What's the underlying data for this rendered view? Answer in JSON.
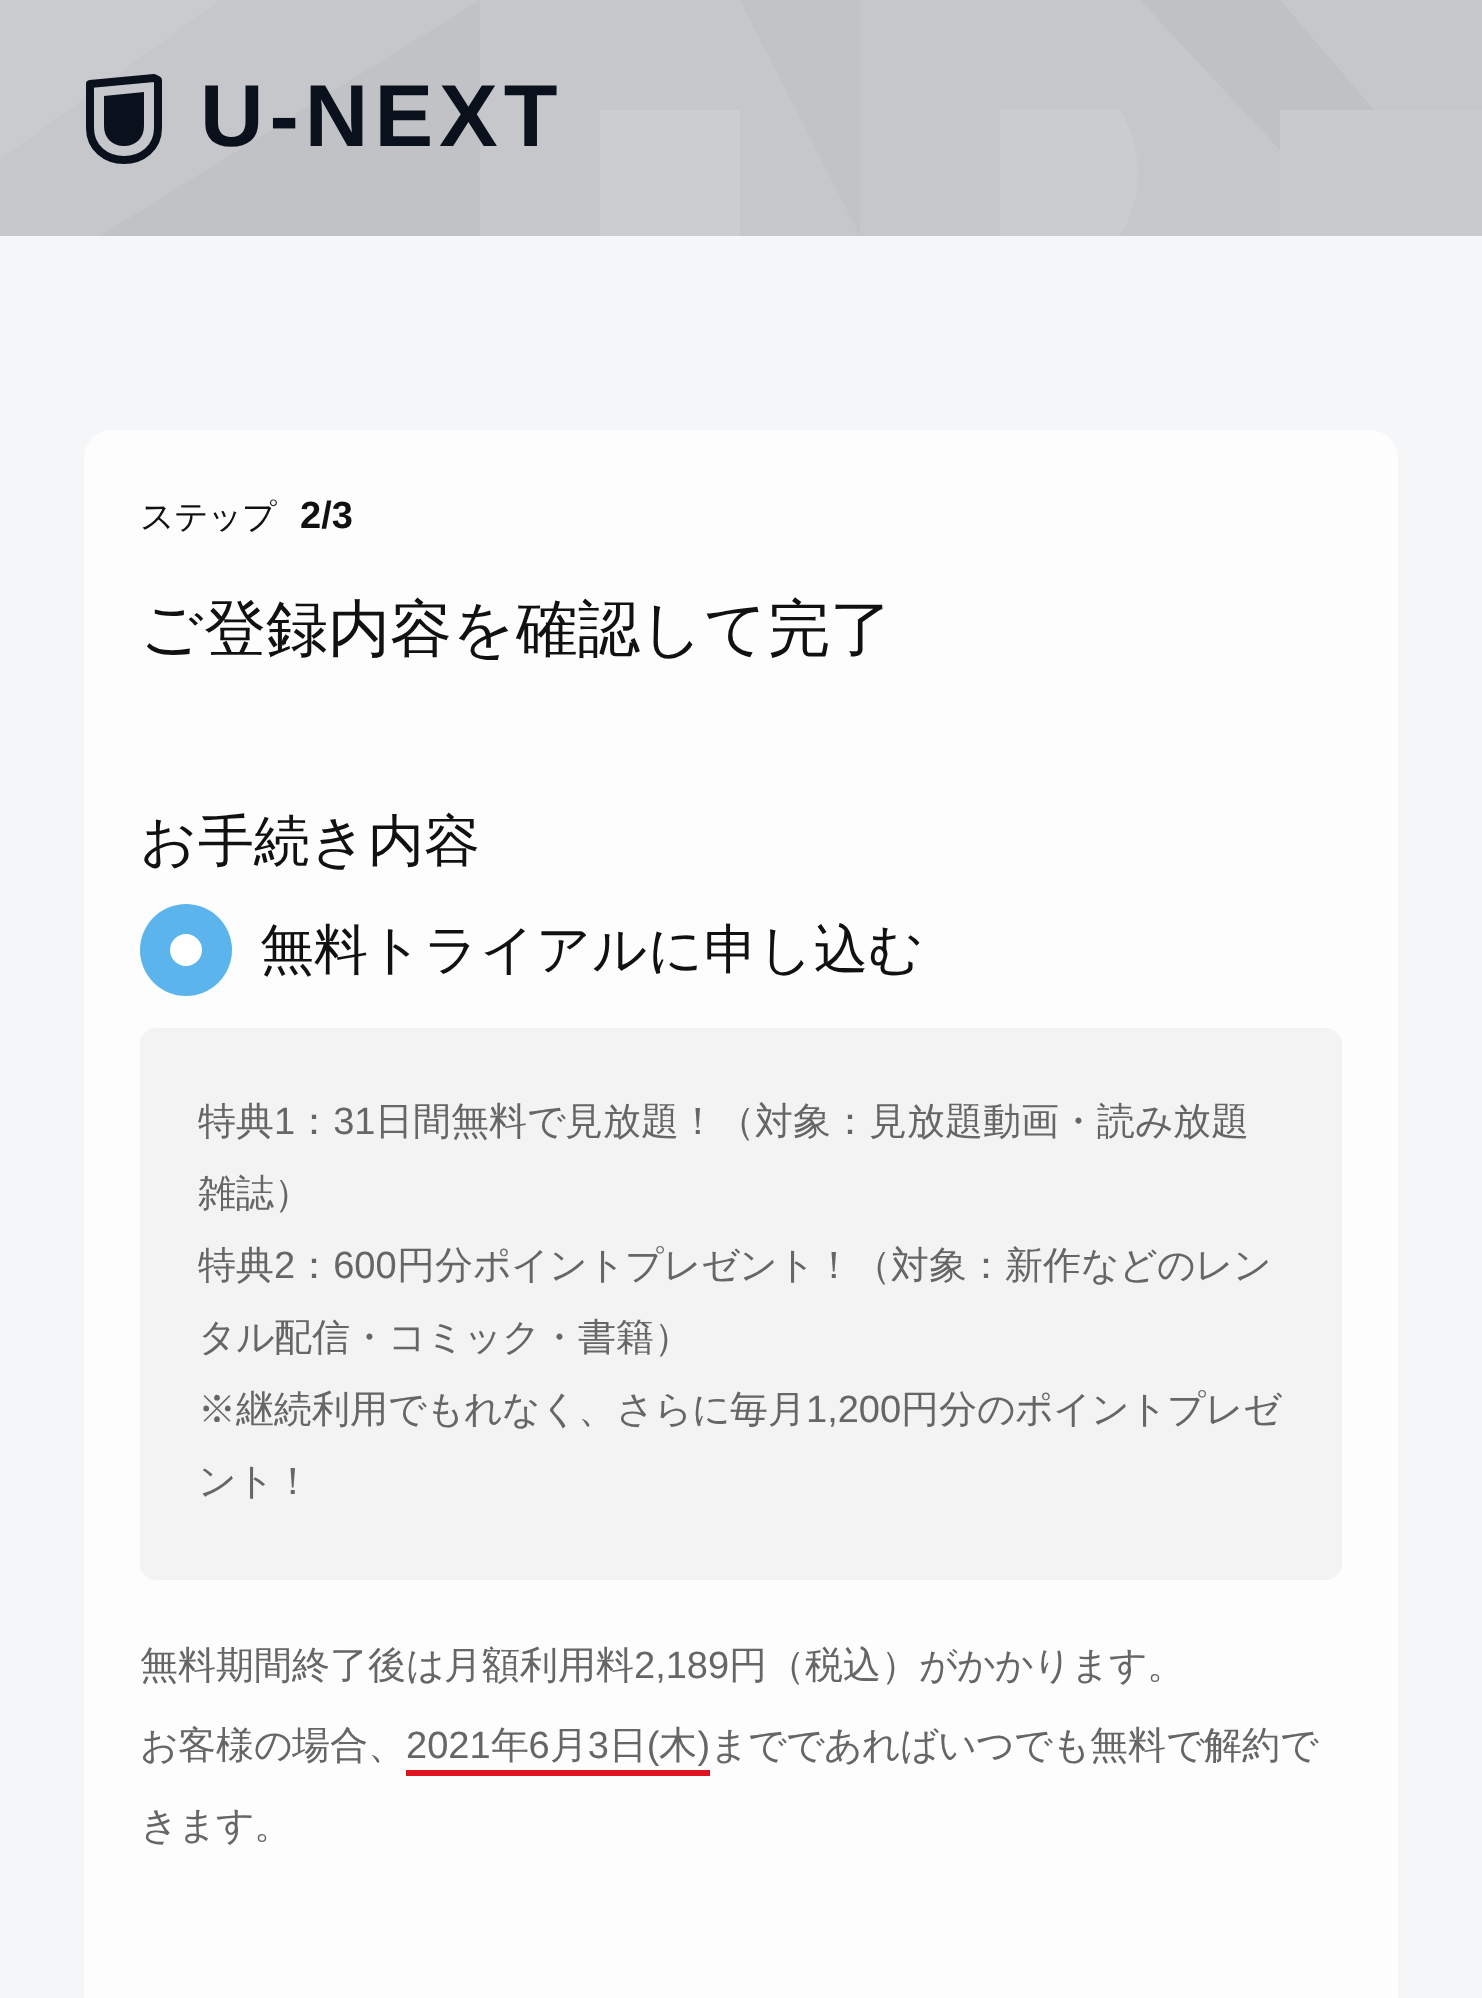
{
  "header": {
    "logo_text": "U-NEXT"
  },
  "step": {
    "label": "ステップ",
    "value": "2/3"
  },
  "title": "ご登録内容を確認して完了",
  "section_title": "お手続き内容",
  "option": {
    "label": "無料トライアルに申し込む",
    "selected": true
  },
  "benefits": [
    "特典1：31日間無料で見放題！（対象：見放題動画・読み放題雑誌）",
    "特典2：600円分ポイントプレゼント！（対象：新作などのレンタル配信・コミック・書籍）",
    "※継続利用でもれなく、さらに毎月1,200円分のポイントプレゼント！"
  ],
  "fee_notice": "無料期間終了後は月額利用料2,189円（税込）がかかります。",
  "cancel_notice": {
    "before": "お客様の場合、",
    "highlight": "2021年6月3日(木)",
    "after": "までであればいつでも無料で解約できます。"
  }
}
